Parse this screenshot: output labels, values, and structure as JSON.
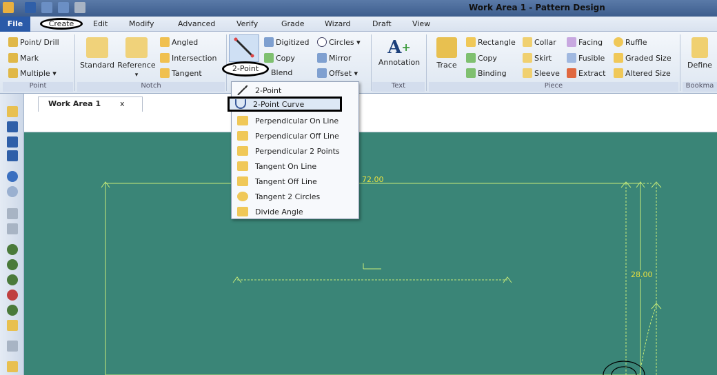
{
  "window": {
    "title": "Work Area 1 - Pattern Design"
  },
  "tabs": [
    "File",
    "Create",
    "Edit",
    "Modify",
    "Advanced",
    "Verify",
    "Grade",
    "Wizard",
    "Draft",
    "View"
  ],
  "ribbon": {
    "point_group": {
      "label": "Point",
      "items": [
        "Point/ Drill",
        "Mark",
        "Multiple ▾"
      ]
    },
    "notch_group": {
      "label": "Notch",
      "standard": "Standard",
      "reference": "Reference",
      "reference_arrow": "▾",
      "items": [
        "Angled",
        "Intersection",
        "Tangent"
      ]
    },
    "line_group": {
      "two_point": "2-Point",
      "items": [
        "Digitized",
        "Copy",
        "Blend",
        "Circles ▾",
        "Mirror",
        "Offset ▾"
      ]
    },
    "text_group": {
      "label": "Text",
      "annotation": "Annotation"
    },
    "piece_group": {
      "label": "Piece",
      "trace": "Trace",
      "col1": [
        "Rectangle",
        "Copy",
        "Binding"
      ],
      "col2": [
        "Collar",
        "Skirt",
        "Sleeve"
      ],
      "col3": [
        "Facing",
        "Fusible",
        "Extract"
      ],
      "col4": [
        "Ruffle",
        "Graded Size",
        "Altered Size"
      ]
    },
    "bookmark_group": {
      "label": "Bookma",
      "define": "Define"
    }
  },
  "document": {
    "tab_label": "Work Area 1",
    "close": "x"
  },
  "canvas": {
    "dim_width": "72.00",
    "dim_height": "28.00"
  },
  "dropdown": {
    "items": [
      "2-Point",
      "2-Point Curve",
      "Perpendicular On Line",
      "Perpendicular Off Line",
      "Perpendicular 2 Points",
      "Tangent On Line",
      "Tangent Off Line",
      "Tangent 2 Circles",
      "Divide Angle"
    ],
    "selected_index": 1
  },
  "colors": {
    "canvas": "#3a8577",
    "pattern_line": "#c8ec78",
    "dimension": "#e8e040",
    "file_tab": "#2a5aa8"
  }
}
